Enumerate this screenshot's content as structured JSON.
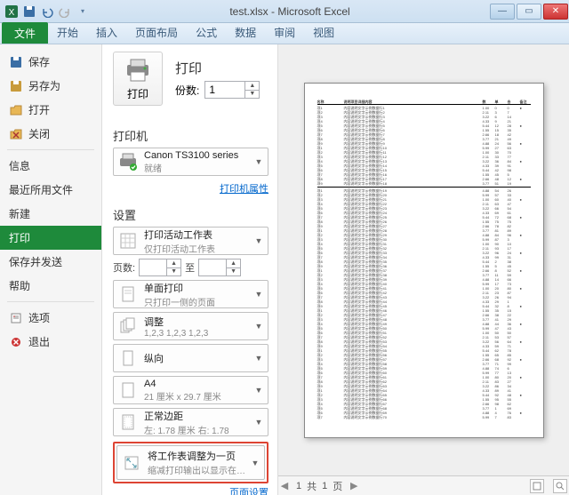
{
  "titlebar": {
    "title": "test.xlsx - Microsoft Excel"
  },
  "ribbon": {
    "file": "文件",
    "tabs": [
      "开始",
      "插入",
      "页面布局",
      "公式",
      "数据",
      "审阅",
      "视图"
    ]
  },
  "leftnav": {
    "save": "保存",
    "saveas": "另存为",
    "open": "打开",
    "close": "关闭",
    "info": "信息",
    "recent": "最近所用文件",
    "new": "新建",
    "print": "打印",
    "savesend": "保存并发送",
    "help": "帮助",
    "options": "选项",
    "exit": "退出"
  },
  "print": {
    "heading": "打印",
    "bigbtn": "打印",
    "copies_label": "份数:",
    "copies_value": "1",
    "printer_heading": "打印机",
    "printer_name": "Canon TS3100 series",
    "printer_status": "就绪",
    "printer_props": "打印机属性",
    "settings_heading": "设置",
    "scope_t1": "打印活动工作表",
    "scope_t2": "仅打印活动工作表",
    "pages_label": "页数:",
    "pages_to": "至",
    "sides_t1": "单面打印",
    "sides_t2": "只打印一侧的页面",
    "collate_t1": "调整",
    "collate_t2": "1,2,3    1,2,3    1,2,3",
    "orient_t1": "纵向",
    "paper_t1": "A4",
    "paper_t2": "21 厘米 x 29.7 厘米",
    "margins_t1": "正常边距",
    "margins_t2": "左: 1.78 厘米  右: 1.78",
    "fit_t1": "将工作表调整为一页",
    "fit_t2": "缩减打印输出以显示在一个…",
    "page_setup": "页面设置"
  },
  "footbar": {
    "page_of_prefix": "共",
    "page_of_suffix": "页",
    "current": "1",
    "total": "1"
  }
}
